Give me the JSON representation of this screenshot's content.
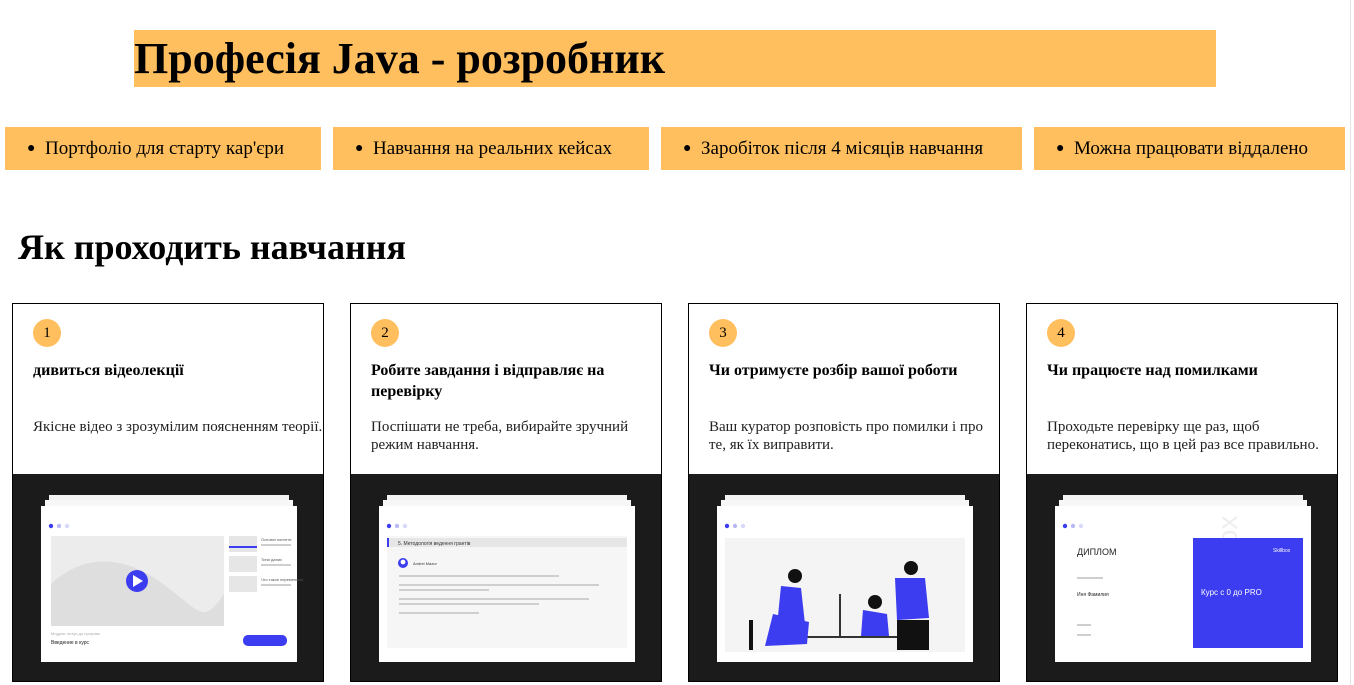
{
  "header": {
    "title": "Професія Java - розробник"
  },
  "features": [
    "Портфоліо для старту кар'єри",
    "Навчання на реальних кейсах",
    "Заробіток після 4 місяців навчання",
    "Можна працювати віддалено"
  ],
  "section": {
    "title": "Як проходить навчання"
  },
  "steps": [
    {
      "num": "1",
      "title": "дивиться відеолекції",
      "desc": "Якісне відео з зрозумілим поясненням теорії.",
      "preview": {
        "caption_small": "Модуль: вступ до програм",
        "caption": "Введение в курс",
        "items": [
          "Основні поняття",
          "Типи даних",
          "Что такое переменные"
        ]
      }
    },
    {
      "num": "2",
      "title": "Робите завдання і відправляє на перевірку",
      "desc": "Поспішати не треба, вибирайте зручний режим навчання.",
      "preview": {
        "heading": "5. Методологія ведення грантів",
        "author": "Andrei Mazur"
      }
    },
    {
      "num": "3",
      "title": "Чи отримуєте розбір вашої роботи",
      "desc": "Ваш куратор розповість про помилки і про те, як їх виправити.",
      "preview": {}
    },
    {
      "num": "4",
      "title": "Чи працюєте над помилками",
      "desc": "Проходьте перевірку ще раз, щоб переконатись, що в цей раз все правильно.",
      "preview": {
        "diploma": "ДИПЛОМ",
        "name": "Иня Фамилия",
        "course": "Курс с 0 до PRO",
        "brand": "Skillbox",
        "watermark": "Skillbox"
      }
    }
  ],
  "colors": {
    "accent": "#ffbf5e",
    "preview_bg": "#1b1b1b",
    "brand_blue": "#3c3cf0"
  }
}
